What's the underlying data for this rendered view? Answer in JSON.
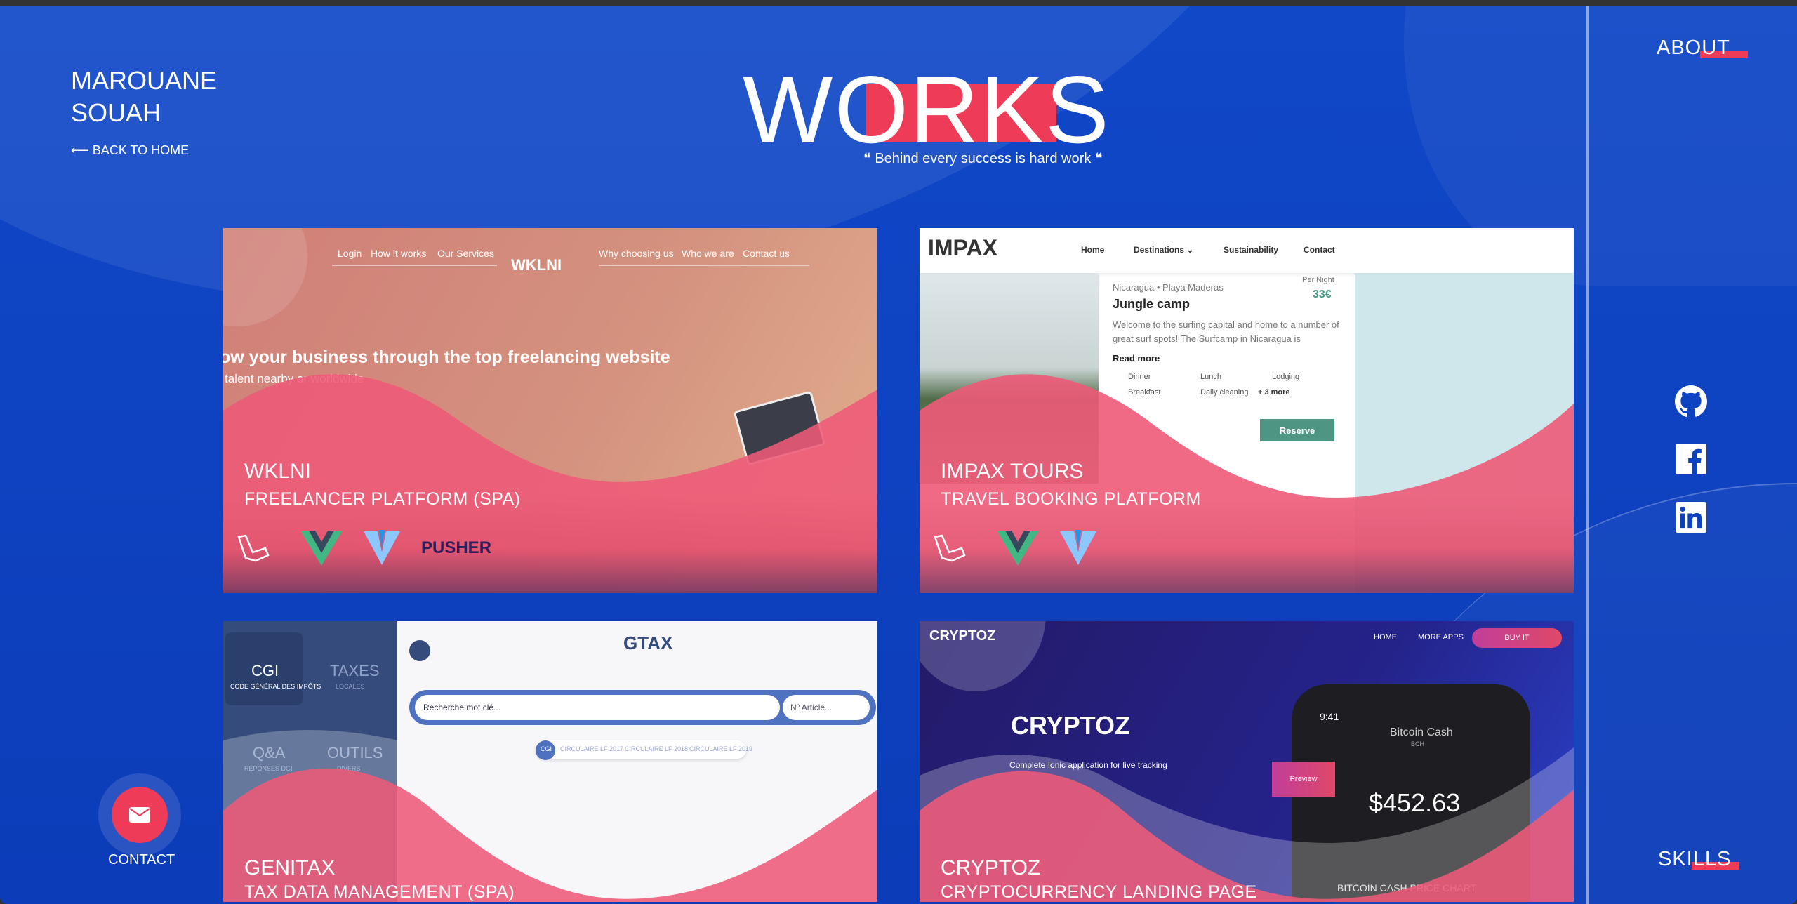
{
  "header": {
    "name_line1": "MAROUANE",
    "name_line2": "SOUAH",
    "back_label": "⟵ BACK TO HOME",
    "title": "WORKS",
    "quote": "❝ Behind every success is hard work ❝"
  },
  "nav": {
    "about": "ABOUT",
    "skills": "SKILLS",
    "contact": "CONTACT"
  },
  "social": [
    "github-icon",
    "facebook-icon",
    "linkedin-icon"
  ],
  "colors": {
    "background": "#0d42c0",
    "accent": "#ee3b57"
  },
  "projects": [
    {
      "title": "WKLNI",
      "subtitle": "FREELANCER PLATFORM (SPA)",
      "tech": [
        "laravel",
        "vue",
        "vuetify",
        "PUSHER"
      ],
      "preview": {
        "nav_left": [
          "Login",
          "How it works",
          "Our Services"
        ],
        "logo": "WKLNI",
        "nav_right": [
          "Why choosing us",
          "Who we are",
          "Contact us"
        ],
        "headline": "ow your business through the top freelancing website",
        "tagline": "talent nearby or worldwide"
      }
    },
    {
      "title": "IMPAX TOURS",
      "subtitle": "TRAVEL BOOKING PLATFORM",
      "tech": [
        "laravel",
        "vue",
        "vuetify"
      ],
      "preview": {
        "logo": "IMPAX",
        "nav": [
          "Home",
          "Destinations ⌄",
          "Sustainability",
          "Contact"
        ],
        "location": "Nicaragua • Playa Maderas",
        "name": "Jungle camp",
        "per_night": "Per Night",
        "price": "33€",
        "desc": "Welcome to the surfing capital and home to a number of great surf spots! The Surfcamp in Nicaragua is",
        "read_more": "Read more",
        "amenities": [
          "Dinner",
          "Lunch",
          "Lodging",
          "Breakfast",
          "Daily cleaning",
          "+ 3 more"
        ],
        "reserve": "Reserve"
      }
    },
    {
      "title": "GENITAX",
      "subtitle": "TAX DATA MANAGEMENT (SPA)",
      "preview": {
        "side": [
          {
            "t": "CGI",
            "s": "CODE GÉNÉRAL DES IMPÔTS"
          },
          {
            "t": "TAXES",
            "s": "LOCALES"
          },
          {
            "t": "Q&A",
            "s": "RÉPONSES DGI"
          },
          {
            "t": "OUTILS",
            "s": "DIVERS"
          }
        ],
        "logo": "GTAX",
        "search": "Recherche mot clé...",
        "article": "Nº Article...",
        "chips": [
          "CGI",
          "CIRCULAIRE LF 2017",
          "CIRCULAIRE LF 2018",
          "CIRCULAIRE LF 2019"
        ]
      }
    },
    {
      "title": "CRYPTOZ",
      "subtitle": "CRYPTOCURRENCY LANDING PAGE",
      "preview": {
        "logo": "CRYPTOZ",
        "nav": [
          "HOME",
          "MORE APPS",
          "BUY IT"
        ],
        "desc": "Complete Ionic application for live tracking",
        "time": "9:41",
        "coin": "Bitcoin Cash",
        "symbol": "BCH",
        "price": "$452.63",
        "preview_btn": "Preview",
        "chart_title": "BITCOIN CASH PRICE CHART"
      }
    }
  ]
}
